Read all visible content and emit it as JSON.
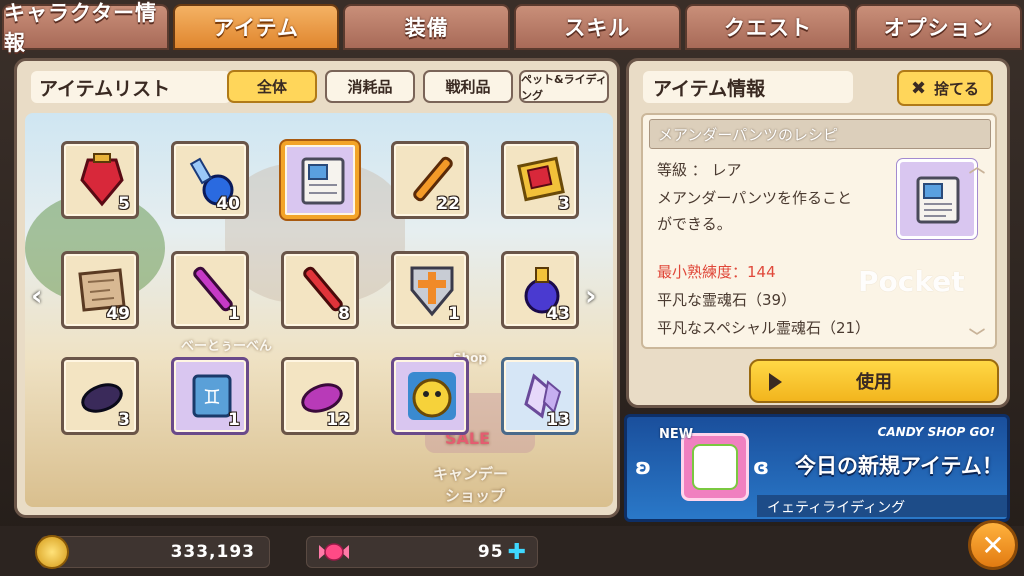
{
  "tabs": [
    "キャラクター情報",
    "アイテム",
    "装備",
    "スキル",
    "クエスト",
    "オプション"
  ],
  "active_tab": 1,
  "item_list": {
    "title": "アイテムリスト",
    "filters": [
      "全体",
      "消耗品",
      "戦利品",
      "ペット&ライディング"
    ],
    "active_filter": 0
  },
  "scene_text": {
    "shop_top": "Shop",
    "sale": "SALE",
    "candy_shop": "キャンデー",
    "candy_shop2": "ショップ",
    "player_name": "べーとぅーべん"
  },
  "items": [
    {
      "icon": "red-gem-potion-icon",
      "count": "5",
      "style": "normal"
    },
    {
      "icon": "blue-potion-icon",
      "count": "40",
      "style": "normal"
    },
    {
      "icon": "recipe-scroll-icon",
      "count": "",
      "style": "selected"
    },
    {
      "icon": "orange-vial-icon",
      "count": "22",
      "style": "normal"
    },
    {
      "icon": "gold-frame-icon",
      "count": "3",
      "style": "normal"
    },
    {
      "icon": "map-scroll-icon",
      "count": "49",
      "style": "normal"
    },
    {
      "icon": "purple-vial-icon",
      "count": "1",
      "style": "normal"
    },
    {
      "icon": "red-vial-icon",
      "count": "8",
      "style": "normal"
    },
    {
      "icon": "cross-shield-icon",
      "count": "1",
      "style": "normal"
    },
    {
      "icon": "mana-elixir-icon",
      "count": "43",
      "style": "normal"
    },
    {
      "icon": "dark-soul-stone-icon",
      "count": "3",
      "style": "normal"
    },
    {
      "icon": "gemini-scroll-icon",
      "count": "1",
      "style": "purple"
    },
    {
      "icon": "pink-soul-stone-icon",
      "count": "12",
      "style": "normal"
    },
    {
      "icon": "yellow-pet-icon",
      "count": "",
      "style": "purple"
    },
    {
      "icon": "crystal-shard-icon",
      "count": "13",
      "style": "bluebg"
    }
  ],
  "pager": {
    "pages": 2,
    "current": 0
  },
  "item_info": {
    "title": "アイテム情報",
    "discard_label": "捨てる",
    "name": "メアンダーパンツのレシピ",
    "grade_line": "等級 ： レア",
    "desc_line1": "メアンダーパンツを作ること",
    "desc_line2": "ができる。",
    "min_skill": "最小熟練度：144",
    "material1": "平凡な霊魂石（39）",
    "material2": "平凡なスペシャル霊魂石（21）",
    "watermark": "Pocket",
    "use_label": "使用"
  },
  "banner": {
    "new_tag": "NEW",
    "shop_label": "CANDY SHOP GO!",
    "headline": "今日の新規アイテム！",
    "item_name": "イェティライディング"
  },
  "currency": {
    "meso": "333,193",
    "candy": "95"
  },
  "colors": {
    "active_tab": "#e0862e",
    "selected_slot": "#f3a428",
    "accent_yellow": "#ffd65a",
    "banner_blue": "#1a4f9c",
    "red_text": "#e0483a"
  }
}
